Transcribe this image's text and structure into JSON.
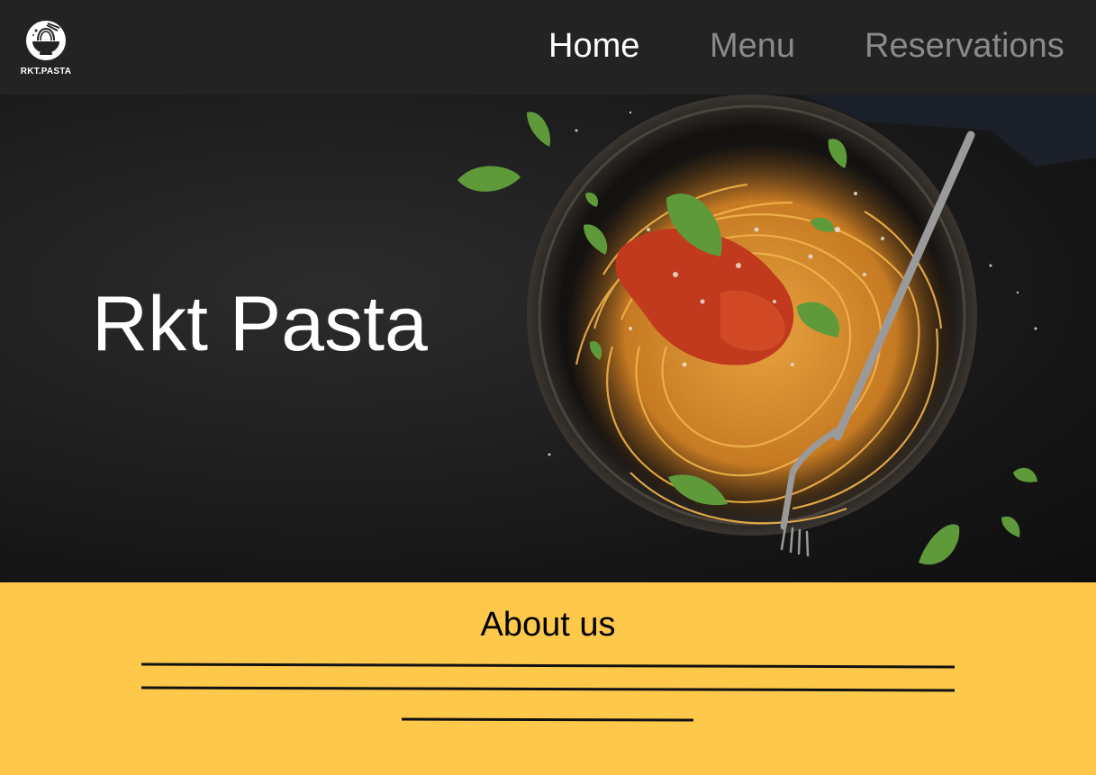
{
  "brand": {
    "logo_icon": "noodle-bowl-icon",
    "name": "RKT.PASTA"
  },
  "nav": {
    "items": [
      {
        "label": "Home",
        "active": true
      },
      {
        "label": "Menu",
        "active": false
      },
      {
        "label": "Reservations",
        "active": false
      }
    ]
  },
  "hero": {
    "title": "Rkt Pasta",
    "image": "spaghetti-plate-photo"
  },
  "about": {
    "title": "About us",
    "body_placeholder": "text-placeholder-lines"
  },
  "colors": {
    "navbar": "#232323",
    "accent": "#fec84b",
    "nav_active": "#ffffff",
    "nav_inactive": "#8a8a8a"
  }
}
